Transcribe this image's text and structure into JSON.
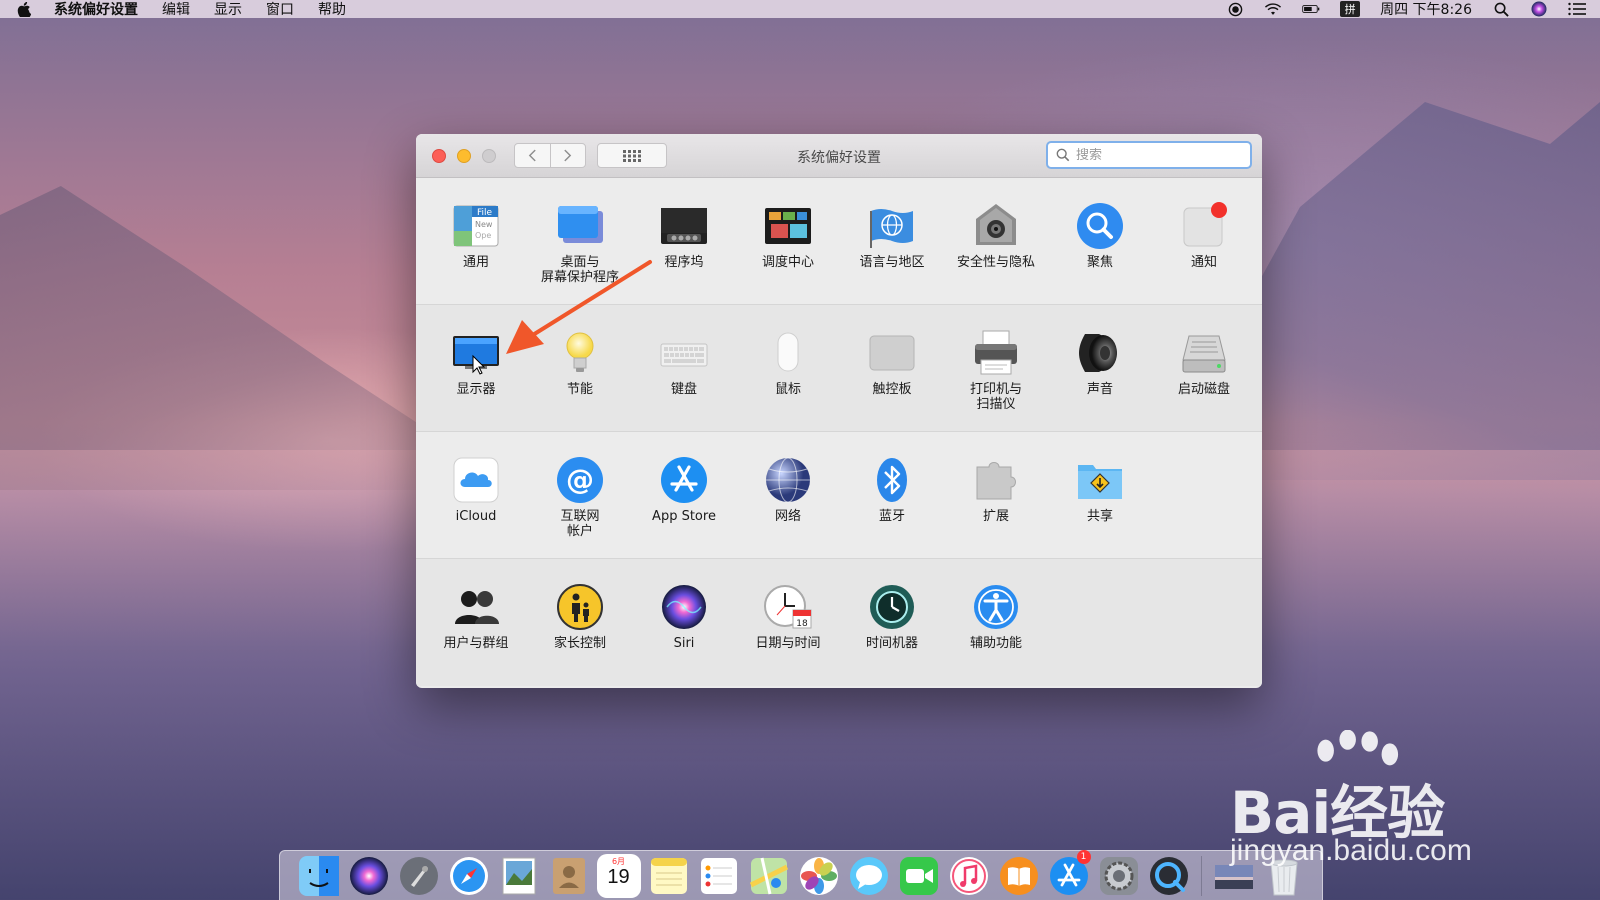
{
  "menubar": {
    "app_name": "系统偏好设置",
    "items": [
      "编辑",
      "显示",
      "窗口",
      "帮助"
    ],
    "clock": "周四 下午8:26",
    "input_method": "拼"
  },
  "window": {
    "title": "系统偏好设置",
    "search_placeholder": "搜索"
  },
  "sections": [
    {
      "panes": [
        {
          "label": "通用",
          "icon": "general-icon"
        },
        {
          "label": "桌面与\n屏幕保护程序",
          "icon": "desktop-screensaver-icon"
        },
        {
          "label": "程序坞",
          "icon": "dock-icon"
        },
        {
          "label": "调度中心",
          "icon": "mission-control-icon"
        },
        {
          "label": "语言与地区",
          "icon": "language-region-icon"
        },
        {
          "label": "安全性与隐私",
          "icon": "security-privacy-icon"
        },
        {
          "label": "聚焦",
          "icon": "spotlight-icon"
        },
        {
          "label": "通知",
          "icon": "notifications-icon"
        }
      ]
    },
    {
      "panes": [
        {
          "label": "显示器",
          "icon": "displays-icon"
        },
        {
          "label": "节能",
          "icon": "energy-saver-icon"
        },
        {
          "label": "键盘",
          "icon": "keyboard-icon"
        },
        {
          "label": "鼠标",
          "icon": "mouse-icon"
        },
        {
          "label": "触控板",
          "icon": "trackpad-icon"
        },
        {
          "label": "打印机与\n扫描仪",
          "icon": "printers-scanners-icon"
        },
        {
          "label": "声音",
          "icon": "sound-icon"
        },
        {
          "label": "启动磁盘",
          "icon": "startup-disk-icon"
        }
      ]
    },
    {
      "panes": [
        {
          "label": "iCloud",
          "icon": "icloud-icon"
        },
        {
          "label": "互联网\n帐户",
          "icon": "internet-accounts-icon"
        },
        {
          "label": "App Store",
          "icon": "app-store-icon"
        },
        {
          "label": "网络",
          "icon": "network-icon"
        },
        {
          "label": "蓝牙",
          "icon": "bluetooth-icon"
        },
        {
          "label": "扩展",
          "icon": "extensions-icon"
        },
        {
          "label": "共享",
          "icon": "sharing-icon"
        }
      ]
    },
    {
      "panes": [
        {
          "label": "用户与群组",
          "icon": "users-groups-icon"
        },
        {
          "label": "家长控制",
          "icon": "parental-controls-icon"
        },
        {
          "label": "Siri",
          "icon": "siri-icon"
        },
        {
          "label": "日期与时间",
          "icon": "date-time-icon"
        },
        {
          "label": "时间机器",
          "icon": "time-machine-icon"
        },
        {
          "label": "辅助功能",
          "icon": "accessibility-icon"
        }
      ]
    }
  ],
  "dock": {
    "calendar_day": "19",
    "calendar_month": "6月",
    "app_store_badge": "1"
  },
  "watermark": {
    "brand": "Bai经验",
    "url": "jingyan.baidu.com"
  },
  "colors": {
    "accent": "#3b82d6",
    "annotation_arrow": "#f0572a",
    "close": "#fc5f57",
    "minimize": "#fdbc2e"
  }
}
